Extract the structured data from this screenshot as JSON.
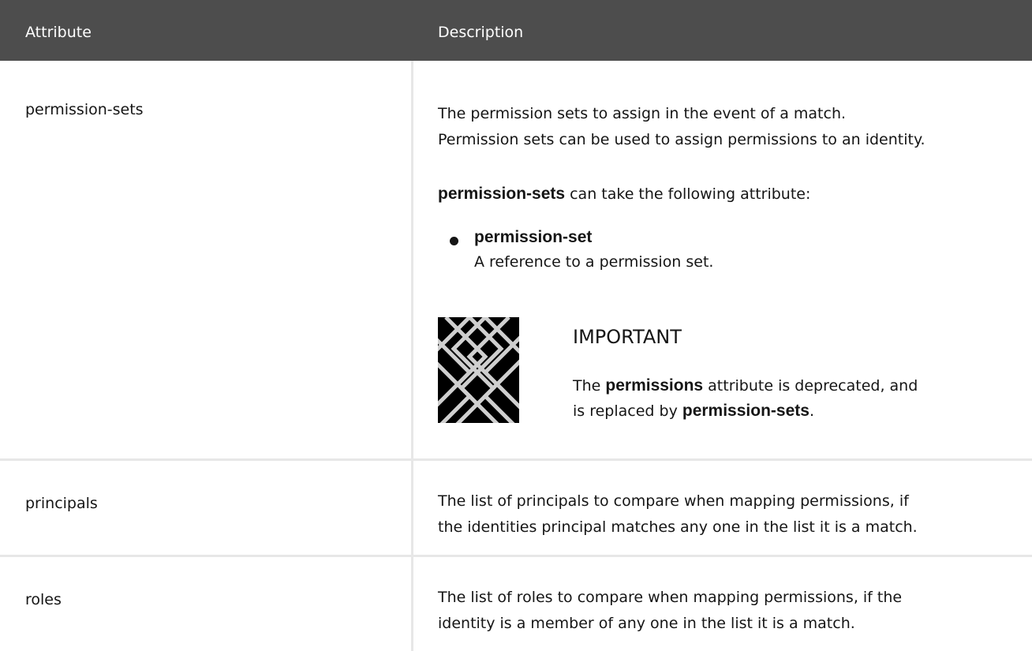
{
  "table": {
    "header": {
      "attribute": "Attribute",
      "description": "Description"
    },
    "rows": [
      {
        "attribute": "permission-sets",
        "description_line1": "The permission sets to assign in the event of a match.",
        "description_line2": "Permission sets can be used to assign permissions to an identity.",
        "subattr_term": "permission-sets",
        "subattr_rest": " can take the following attribute:",
        "bullet": {
          "term": "permission-set",
          "desc": "A reference to a permission set."
        },
        "important": {
          "title": "IMPORTANT",
          "text_1": "The ",
          "term_1": "permissions",
          "text_2": " attribute is deprecated, and",
          "text_3": "is replaced by ",
          "term_2": "permission-sets",
          "text_4": "."
        }
      },
      {
        "attribute": "principals",
        "description_line1": "The list of principals to compare when mapping permissions, if",
        "description_line2": "the identities principal matches any one in the list it is a match."
      },
      {
        "attribute": "roles",
        "description_line1": "The list of roles to compare when mapping permissions, if the",
        "description_line2": "identity is a member of any one in the list it is a match."
      }
    ]
  },
  "icons": {
    "important": "important-pattern-icon"
  }
}
